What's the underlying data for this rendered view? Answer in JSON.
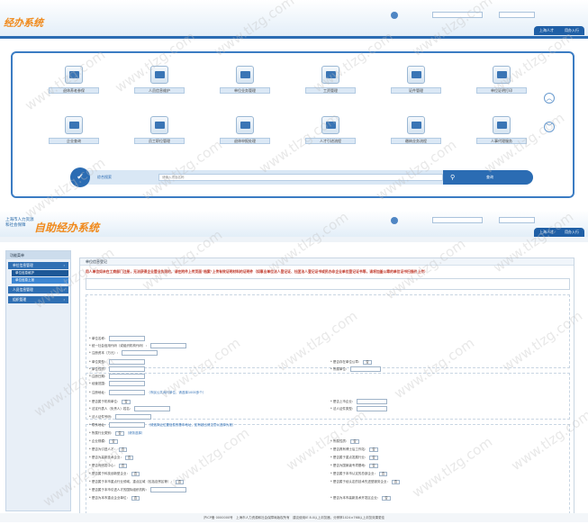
{
  "watermark": "www.tlzg.com",
  "top": {
    "logo": "经办系统",
    "user_field_1": "",
    "user_field_2": "",
    "nav_tabs": [
      "上海人才",
      "用办入行"
    ],
    "tiles": [
      {
        "label": "退休养老参保",
        "icon": "printer-icon"
      },
      {
        "label": "人员信息维护",
        "icon": "edit-icon"
      },
      {
        "label": "单位业务管理",
        "icon": "chat-icon"
      },
      {
        "label": "工资管理",
        "icon": "printer-icon"
      },
      {
        "label": "证件管理",
        "icon": "id-card-icon"
      },
      {
        "label": "单位证明打印",
        "icon": "monitor-icon"
      },
      {
        "label": "企业查询",
        "icon": "monitor-icon"
      },
      {
        "label": "员工职位管理",
        "icon": "org-chart-icon"
      },
      {
        "label": "退休申报处理",
        "icon": "document-icon"
      },
      {
        "label": "人才引进流程",
        "icon": "calendar-icon"
      },
      {
        "label": "缴纳业务流程",
        "icon": "organization-icon"
      },
      {
        "label": "人事代理服务",
        "icon": "chart-icon"
      }
    ],
    "search": {
      "label": "综合搜索",
      "placeholder": "请输入项目名称",
      "button": "查询"
    }
  },
  "bottom": {
    "logo": "自助经办系统",
    "org_line1": "上海市人力资源",
    "org_line2": "和社会保障",
    "nav_tabs": [
      "上海人才",
      "用办入行"
    ],
    "sidebar_title": "功能菜单",
    "sidebar_items": [
      {
        "label": "单位信息管理",
        "subs": [
          "单位信息维护",
          "单位信息上报"
        ]
      },
      {
        "label": "人员信息管理",
        "subs": []
      },
      {
        "label": "组织管理",
        "subs": []
      }
    ],
    "form_title": "单位信息登记",
    "notice": "用人单位如未在工商部门注册，无法获得企业营业执照的，请在附件上传页面\"档案\"上传有效证明材料的证明件（如事业单位法人登记证、社团法人登记证书或民办非企业单位登记证书等，请将加盖公章的单位证书扫描件上传）",
    "fields": [
      {
        "label": "* 单位名称："
      },
      {
        "label": "* 统一社会信用代码（或组织机构代码）："
      },
      {
        "label": "* 注册资本（万元）："
      },
      {
        "label": "* 单位类型：",
        "right_label": "* 是否存在单位公章：",
        "right_value": "否"
      },
      {
        "label": "* 单位性质：",
        "right_label": "* 所属单位："
      },
      {
        "label": "* 注册日期："
      },
      {
        "label": "* 经营范围："
      },
      {
        "label": "* 注册地址：",
        "hint": "（市民公共询问单位，请选择1000多个）"
      },
      {
        "label": "* 是否属于机构单位：",
        "value": "否",
        "right_label": "* 是否上市企业："
      },
      {
        "label": "* 法定代表人（负责人）姓名：",
        "right_label": "* 法人证件类型："
      },
      {
        "label": "* 法人证件号码："
      },
      {
        "label": "* 联系地址：",
        "hint": "（请选择近位置信息的基本地址，如有超出请注意以选择为准）"
      },
      {
        "label": "* 所属行业类别：",
        "value": "否",
        "hint": "（请务选择）"
      },
      {
        "label": "* 企业规模：",
        "value": "否",
        "right_label": "* 所属性质：",
        "right_value": "否"
      },
      {
        "label": "* 是否为引进人才：",
        "value": "否",
        "right_label": "* 是否具有博士后工作站：",
        "right_value": "否"
      },
      {
        "label": "* 是否为高新技术企业：",
        "value": "否",
        "right_label": "* 是否属于重点发展行业：",
        "right_value": "否"
      },
      {
        "label": "* 是否有研发中心：",
        "value": "否",
        "right_label": "* 是否为国家级专项基地：",
        "right_value": "否"
      },
      {
        "label": "* 是否属于科技创新型企业：",
        "value": "否",
        "right_label": "* 是否属于本市认定的总部企业：",
        "right_value": "否"
      },
      {
        "label": "* 是否属于本市重点行业领域、重点区域（包括自贸区等）：",
        "value": "否",
        "right_label": "* 是否属于经认定的技术先进型服务企业：",
        "right_value": "否"
      },
      {
        "label": "* 是否属于本市引进人才的国际组织机构："
      },
      {
        "label": "* 是否为本市重点企业单位：",
        "value": "否",
        "right_label": "* 是否为本市高新技术开发区企业：",
        "right_value": "否"
      }
    ],
    "footer": "沪ICP备 0000000号　上海市人力资源和社会保障局版权所有　建议使用IE 8.0以上浏览器，分辨率1024×768以上浏览效果更佳"
  }
}
